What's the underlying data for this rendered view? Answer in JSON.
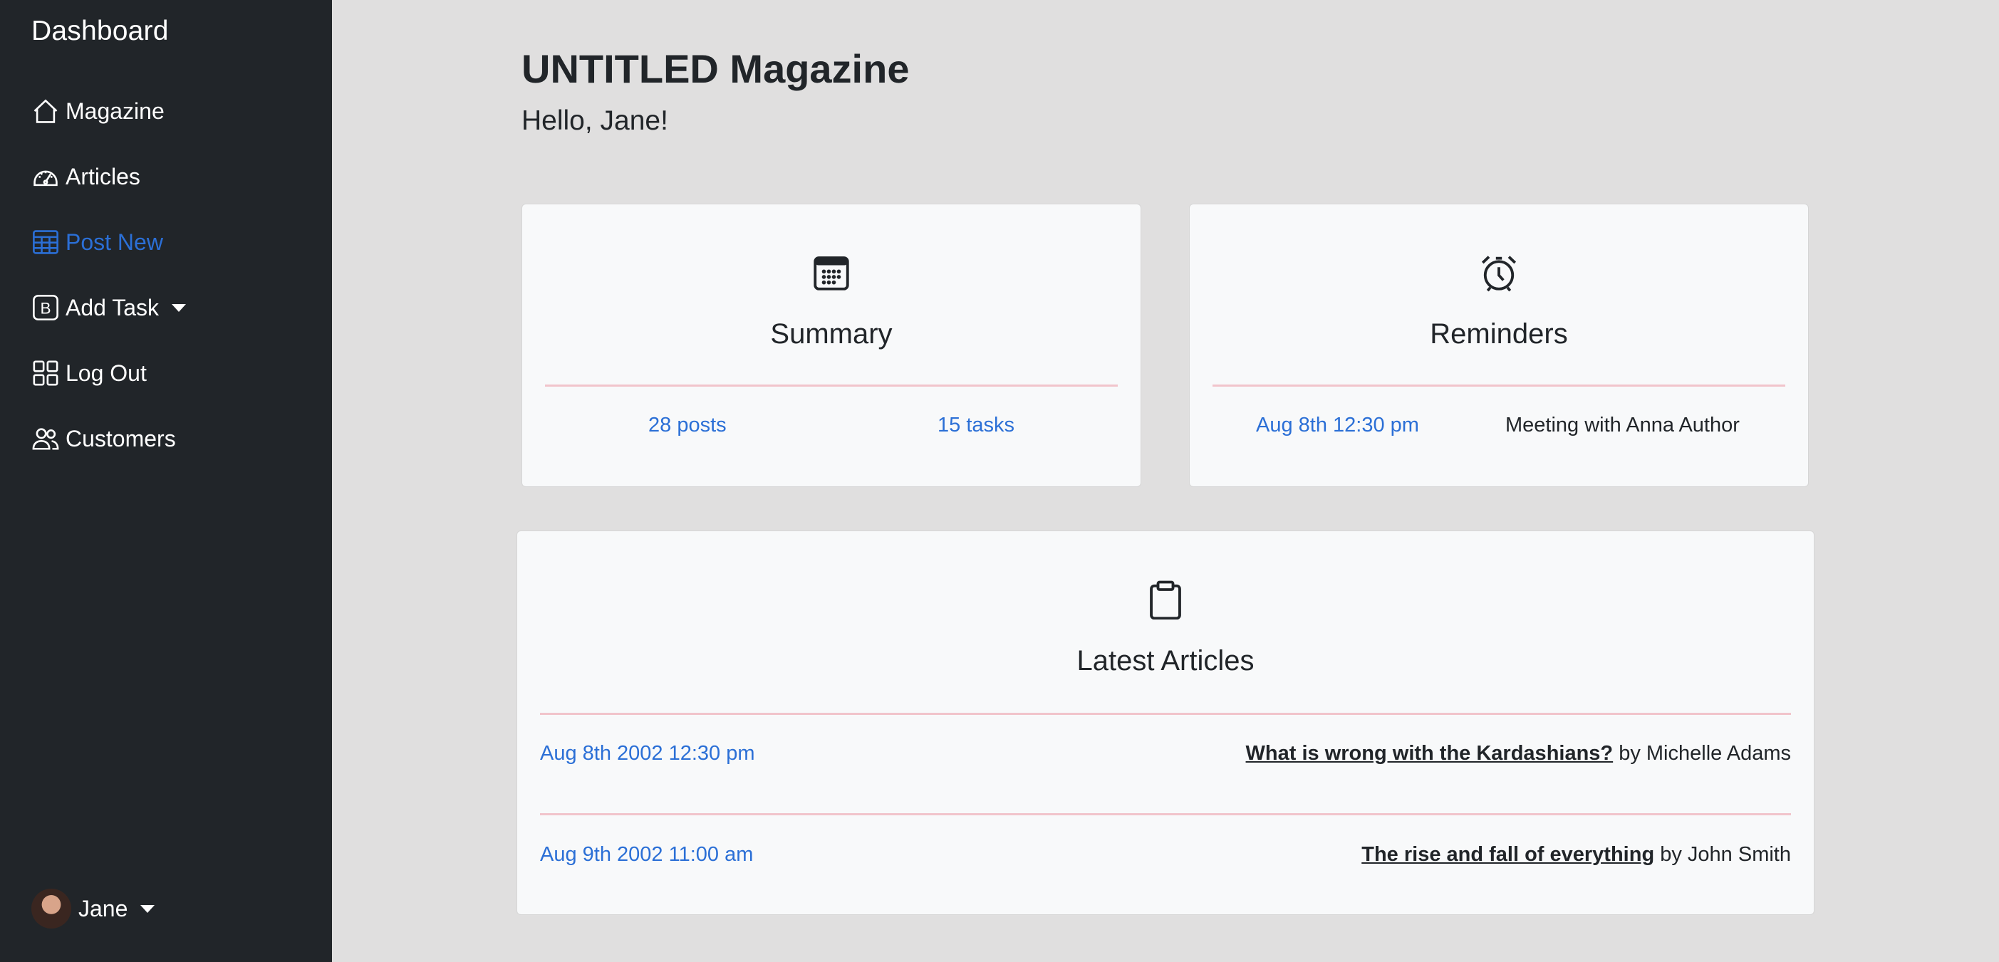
{
  "sidebar": {
    "brand": "Dashboard",
    "items": [
      {
        "label": "Magazine",
        "icon": "house-icon"
      },
      {
        "label": "Articles",
        "icon": "speedometer-icon"
      },
      {
        "label": "Post New",
        "icon": "table-icon",
        "active": true
      },
      {
        "label": "Add Task",
        "icon": "bootstrap-icon",
        "dropdown": true
      },
      {
        "label": "Log Out",
        "icon": "grid-icon"
      },
      {
        "label": "Customers",
        "icon": "people-icon"
      }
    ],
    "user": {
      "name": "Jane"
    }
  },
  "header": {
    "title": "UNTITLED Magazine",
    "greeting": "Hello, Jane!"
  },
  "summary": {
    "icon": "calendar-icon",
    "title": "Summary",
    "posts": "28 posts",
    "tasks": "15 tasks"
  },
  "reminders": {
    "icon": "alarm-icon",
    "title": "Reminders",
    "date": "Aug 8th 12:30 pm",
    "text": "Meeting with Anna Author"
  },
  "latest": {
    "icon": "clipboard-icon",
    "title": "Latest Articles",
    "articles": [
      {
        "date": "Aug 8th 2002 12:30 pm",
        "title": "What is wrong with the Kardashians?",
        "by": "by Michelle Adams"
      },
      {
        "date": "Aug 9th 2002 11:00 am",
        "title": "The rise and fall of everything",
        "by": "by John Smith"
      }
    ]
  },
  "colors": {
    "sidebar_bg": "#212529",
    "accent": "#2b6fd6",
    "page_bg": "#e0dfdf",
    "card_bg": "#f8f9fa",
    "divider": "#f1c4cb"
  }
}
